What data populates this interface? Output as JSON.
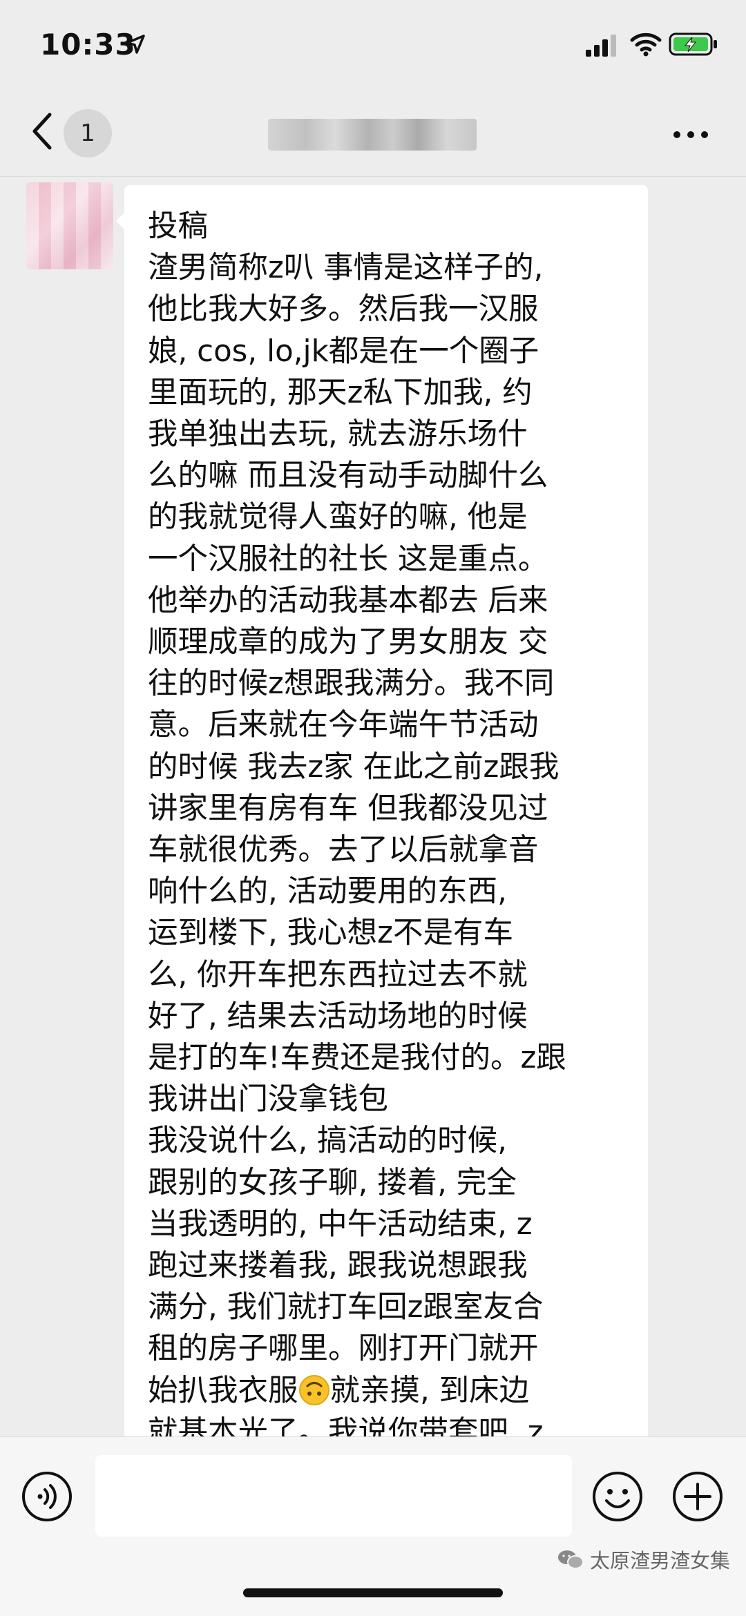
{
  "status_bar": {
    "time": "10:33",
    "icons": [
      "location-arrow-icon",
      "signal-icon",
      "wifi-icon",
      "battery-charging-icon"
    ],
    "battery_color": "#3cc94c"
  },
  "nav": {
    "unread_count": "1",
    "icons": [
      "back-chevron-icon",
      "more-icon"
    ]
  },
  "message": {
    "text_before_emoji": "投稿\n渣男简称z叭 事情是这样子的,\n他比我大好多。然后我一汉服\n娘, cos, lo,jk都是在一个圈子\n里面玩的, 那天z私下加我, 约\n我单独出去玩, 就去游乐场什\n么的嘛 而且没有动手动脚什么\n的我就觉得人蛮好的嘛, 他是\n一个汉服社的社长 这是重点。\n他举办的活动我基本都去 后来\n顺理成章的成为了男女朋友 交\n往的时候z想跟我满分。我不同\n意。后来就在今年端午节活动\n的时候 我去z家 在此之前z跟我\n讲家里有房有车 但我都没见过\n车就很优秀。去了以后就拿音\n响什么的, 活动要用的东西,\n运到楼下, 我心想z不是有车\n么, 你开车把东西拉过去不就\n好了, 结果去活动场地的时候\n是打的车!车费还是我付的。z跟\n我讲出门没拿钱包\n我没说什么, 搞活动的时候,\n跟别的女孩子聊, 搂着, 完全\n当我透明的, 中午活动结束, z\n跑过来搂着我, 跟我说想跟我\n满分, 我们就打车回z跟室友合\n租的房子哪里。刚打开门就开\n始扒我衣服",
    "emoji": "upside-down-face-icon",
    "text_after_emoji": "就亲摸, 到床边\n就基本光了。我说你带套吧, z"
  },
  "input_bar": {
    "placeholder": "",
    "icons": [
      "voice-icon",
      "emoji-icon",
      "plus-icon"
    ]
  },
  "watermark": {
    "text": "太原渣男渣女集"
  }
}
